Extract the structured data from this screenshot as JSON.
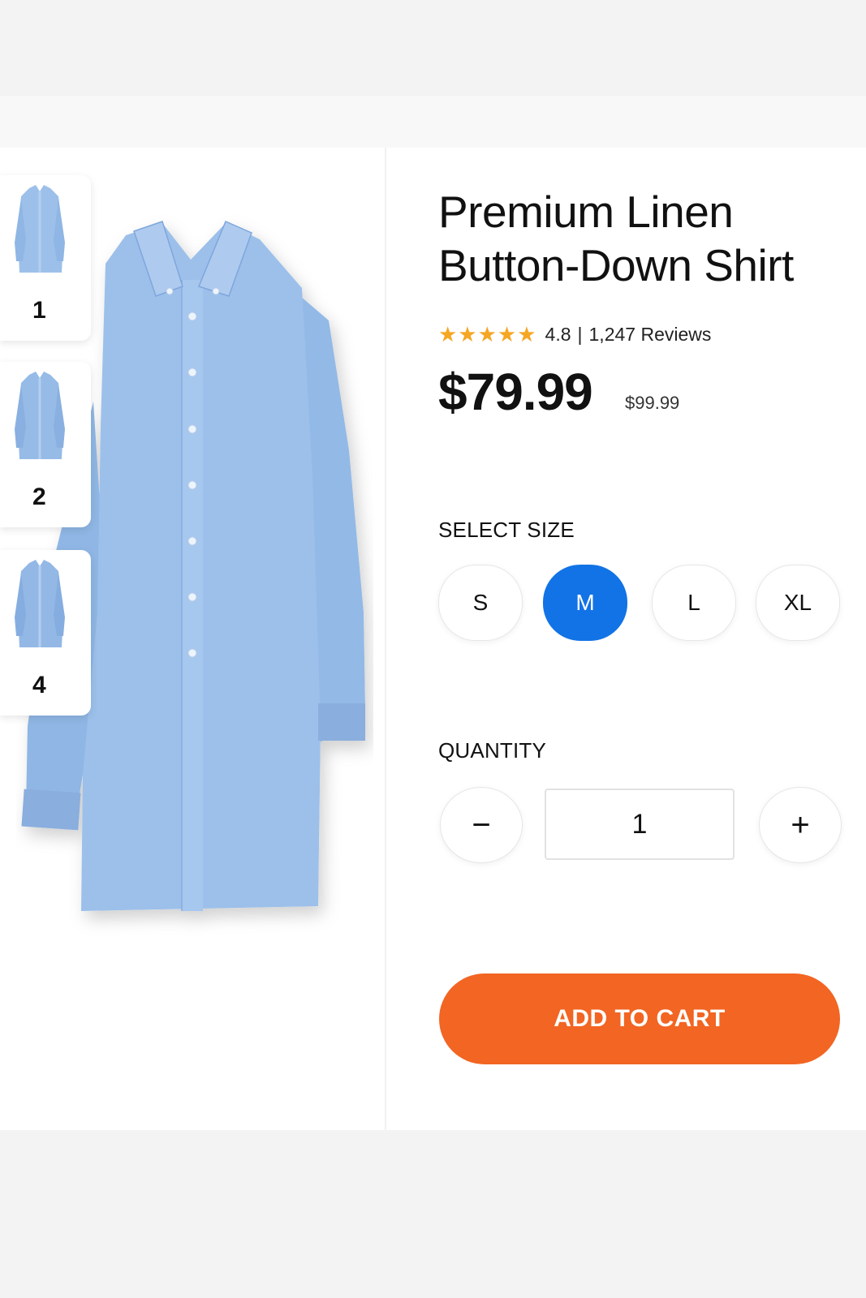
{
  "product": {
    "title_line1": "Premium Linen",
    "title_line2": "Button-Down Shirt",
    "stars": "★★★★★",
    "rating": "4.8",
    "rating_separator": "|",
    "reviews": "1,247 Reviews",
    "price": "$79.99",
    "original_price": "$99.99",
    "image_color": "#9cc0ea"
  },
  "gallery": {
    "thumbnails": [
      {
        "label": "1"
      },
      {
        "label": "2"
      },
      {
        "label": "4"
      }
    ]
  },
  "size": {
    "label": "SELECT SIZE",
    "options": [
      "S",
      "M",
      "L",
      "XL"
    ],
    "selected": "M"
  },
  "quantity": {
    "label": "QUANTITY",
    "minus": "−",
    "plus": "+",
    "value": "1"
  },
  "cart": {
    "button_label": "ADD TO CART",
    "color": "#f26522"
  },
  "colors": {
    "accent": "#1273e6",
    "star": "#f5a623"
  }
}
